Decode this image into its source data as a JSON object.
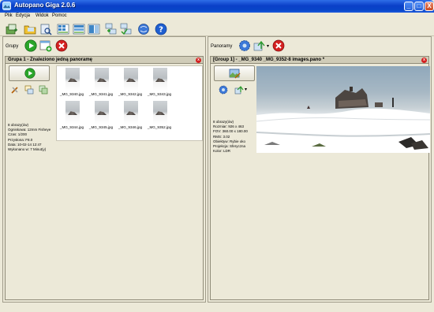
{
  "window": {
    "title": "Autopano Giga 2.0.6",
    "buttons": [
      "_",
      "□",
      "X"
    ]
  },
  "menu": [
    "Plik",
    "Edycja",
    "Widok",
    "Pomoc"
  ],
  "left_panel": {
    "label": "Grupy",
    "group_title": "Grupa 1 - Znaleziono jedną panoramę",
    "thumbnails": [
      "_MG_9340.jpg",
      "_MG_9341.jpg",
      "_MG_9342.jpg",
      "_MG_9343.jpg",
      "_MG_9344.jpg",
      "_MG_9345.jpg",
      "_MG_9346.jpg",
      "_MG_9352.jpg"
    ],
    "info": [
      "8 obrazy(ów)",
      "Ogniskowa: 12mm Fisheye",
      "Czas: 1/200",
      "Przysłona: F8.0",
      "Data: 10-02-14 12:47",
      "Wykonano w: 7 Minut(y)"
    ]
  },
  "right_panel": {
    "label": "Panoramy",
    "pano_title": "[Group 1] - _MG_9340 _MG_9352-8 images.pano *",
    "info": [
      "8 obrazy(ów)",
      "Rozmiar: 926 x 463",
      "FOV: 360.00 x 180.00",
      "RMS: 3.02",
      "Obiektyw: Rybie oko",
      "Projekcja: Sferyczna",
      "Kolor: LDR"
    ]
  },
  "colors": {
    "titlebar": "#0a3fc8",
    "window_bg": "#ece9d8",
    "close_red": "#d42020",
    "run_green": "#2aa52a",
    "help_blue": "#1f5fd0"
  },
  "icons": [
    "app-icon",
    "new-project-icon",
    "open-folder-icon",
    "find-icon",
    "grid-a-icon",
    "grid-b-icon",
    "grid-c-icon",
    "group-a-icon",
    "group-b-icon",
    "web-icon",
    "help-icon",
    "run-icon",
    "add-group-icon",
    "delete-group-icon",
    "settings-gear-icon",
    "export-icon",
    "delete-pano-icon",
    "edit-pano-icon"
  ]
}
